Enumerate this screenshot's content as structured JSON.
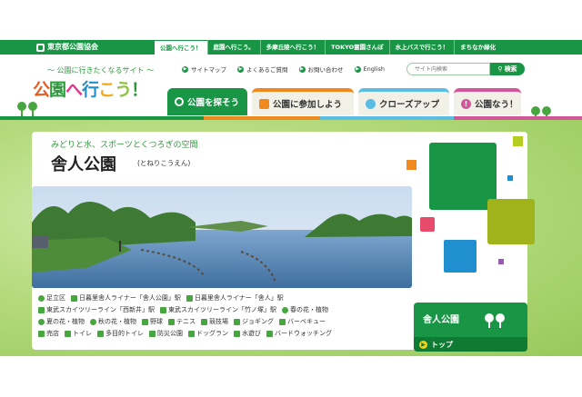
{
  "org": {
    "name": "東京都公園協会"
  },
  "site_tabs": [
    {
      "label": "公園へ行こう！",
      "active": true
    },
    {
      "label": "庭園へ行こう。",
      "active": false
    },
    {
      "label": "多摩丘陵へ行こう！",
      "active": false
    },
    {
      "label": "TOKYO霊園さんぽ",
      "active": false
    },
    {
      "label": "水上バスで行こう！",
      "active": false
    },
    {
      "label": "まちなか緑化",
      "active": false
    }
  ],
  "header": {
    "tagline": "～ 公園に行きたくなるサイト ～",
    "logo": [
      "公",
      "園",
      "へ",
      "行",
      "こ",
      "う",
      "！"
    ]
  },
  "utility": [
    {
      "label": "サイトマップ"
    },
    {
      "label": "よくあるご質問"
    },
    {
      "label": "お問い合わせ"
    },
    {
      "label": "English"
    }
  ],
  "search": {
    "placeholder": "サイト内検索",
    "button": "検索"
  },
  "main_nav": [
    {
      "label": "公園を探そう",
      "icon": "search-icon"
    },
    {
      "label": "公園に参加しよう",
      "icon": "person-icon"
    },
    {
      "label": "クローズアップ",
      "icon": "bulb-icon"
    },
    {
      "label": "公園なう！",
      "icon": "exclamation-icon"
    }
  ],
  "park": {
    "tagline": "みどりと水、スポーツとくつろぎの空間",
    "name": "舎人公園",
    "reading": "(とねりこうえん)"
  },
  "info": {
    "line1": [
      "足立区",
      "日暮里舎人ライナー「舎人公園」駅",
      "日暮里舎人ライナー「舎人」駅"
    ],
    "line2": [
      "東武スカイツリーライン「西新井」駅",
      "東武スカイツリーライン「竹ノ塚」駅",
      "春の花・植物"
    ],
    "line3": [
      "夏の花・植物",
      "秋の花・植物",
      "野球",
      "テニス",
      "競技場",
      "ジョギング",
      "バーベキュー"
    ],
    "line4": [
      "売店",
      "トイレ",
      "多目的トイレ",
      "防災公園",
      "ドッグラン",
      "水遊び",
      "バードウォッチング"
    ]
  },
  "sidebox": {
    "title": "舎人公園",
    "top_link": "トップ"
  },
  "colors": {
    "brand_green": "#199645",
    "accent_orange": "#f08a1f",
    "accent_blue": "#1f8fd0",
    "accent_pink": "#d4569a"
  }
}
